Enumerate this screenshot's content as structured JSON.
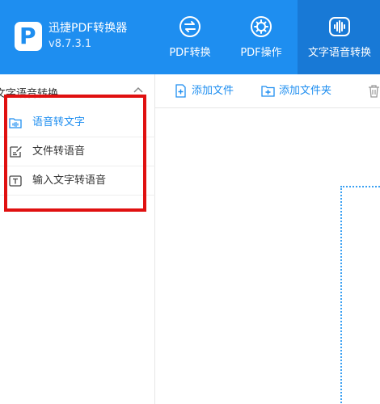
{
  "app": {
    "title": "迅捷PDF转换器",
    "version": "v8.7.3.1",
    "logo_letter": "P"
  },
  "tabs": [
    {
      "label": "PDF转换",
      "icon": "swap-arrows-icon"
    },
    {
      "label": "PDF操作",
      "icon": "gear-icon"
    },
    {
      "label": "文字语音转换",
      "icon": "audio-wave-icon",
      "active": true
    }
  ],
  "sidebar": {
    "header": "文字语音转换",
    "items": [
      {
        "label": "语音转文字",
        "icon": "audio-file-icon",
        "active": true
      },
      {
        "label": "文件转语音",
        "icon": "edit-document-icon"
      },
      {
        "label": "输入文字转语音",
        "icon": "text-box-icon"
      }
    ]
  },
  "toolbar": {
    "add_file": "添加文件",
    "add_folder": "添加文件夹",
    "delete_icon": "trash-icon"
  },
  "colors": {
    "accent": "#1e8ef0",
    "highlight": "#e01010",
    "active_tab": "#1879d6"
  }
}
